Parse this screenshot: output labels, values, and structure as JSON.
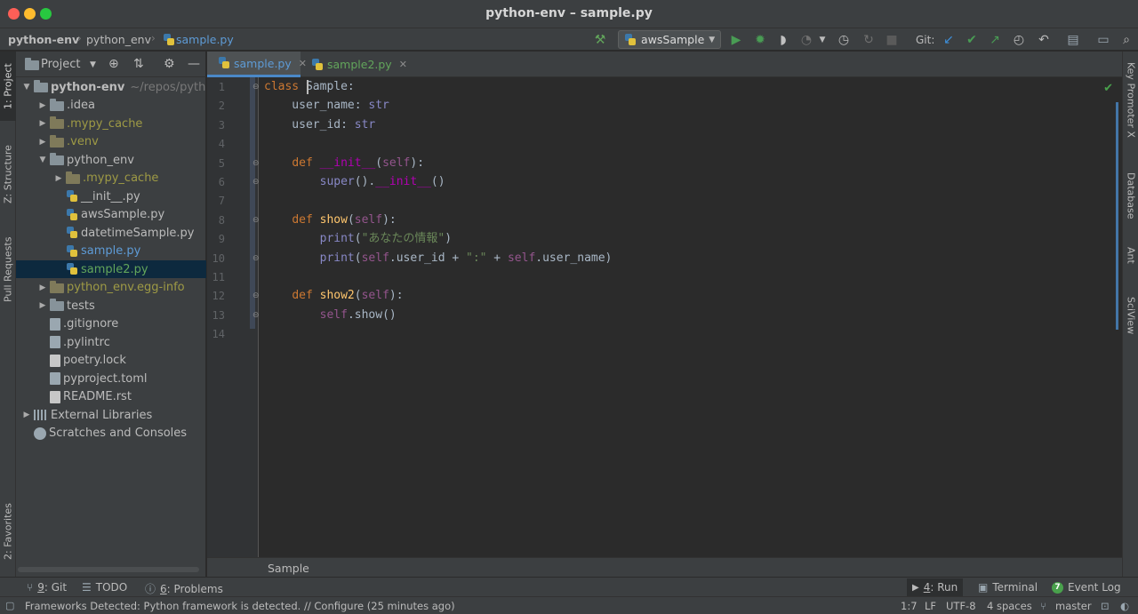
{
  "window": {
    "title": "python-env – sample.py"
  },
  "navbar": {
    "crumbs": [
      "python-env",
      "python_env",
      "sample.py"
    ],
    "run_config": "awsSample",
    "git_label": "Git:"
  },
  "left_strip": {
    "project": "1: Project",
    "structure": "Z: Structure",
    "pull_requests": "Pull Requests",
    "favorites": "2: Favorites"
  },
  "project_panel": {
    "title": "Project",
    "tree": [
      {
        "label": "python-env",
        "suffix": "~/repos/pytho",
        "kind": "folder",
        "depth": 0,
        "arrow": "down",
        "style": "bold"
      },
      {
        "label": ".idea",
        "kind": "folder",
        "depth": 1,
        "arrow": "right",
        "style": "normal"
      },
      {
        "label": ".mypy_cache",
        "kind": "folder-excluded",
        "depth": 1,
        "arrow": "right",
        "style": "excluded"
      },
      {
        "label": ".venv",
        "kind": "folder-excluded",
        "depth": 1,
        "arrow": "right",
        "style": "excluded"
      },
      {
        "label": "python_env",
        "kind": "folder",
        "depth": 1,
        "arrow": "down",
        "style": "normal"
      },
      {
        "label": ".mypy_cache",
        "kind": "folder-excluded",
        "depth": 2,
        "arrow": "right",
        "style": "excluded"
      },
      {
        "label": "__init__.py",
        "kind": "py",
        "depth": 2,
        "arrow": "",
        "style": "normal"
      },
      {
        "label": "awsSample.py",
        "kind": "py",
        "depth": 2,
        "arrow": "",
        "style": "normal"
      },
      {
        "label": "datetimeSample.py",
        "kind": "py",
        "depth": 2,
        "arrow": "",
        "style": "normal"
      },
      {
        "label": "sample.py",
        "kind": "py",
        "depth": 2,
        "arrow": "",
        "style": "blue"
      },
      {
        "label": "sample2.py",
        "kind": "py",
        "depth": 2,
        "arrow": "",
        "style": "green",
        "selected": true
      },
      {
        "label": "python_env.egg-info",
        "kind": "folder-excluded",
        "depth": 1,
        "arrow": "right",
        "style": "excluded"
      },
      {
        "label": "tests",
        "kind": "folder",
        "depth": 1,
        "arrow": "right",
        "style": "normal"
      },
      {
        "label": ".gitignore",
        "kind": "gear",
        "depth": 1,
        "arrow": "",
        "style": "normal"
      },
      {
        "label": ".pylintrc",
        "kind": "gear",
        "depth": 1,
        "arrow": "",
        "style": "normal"
      },
      {
        "label": "poetry.lock",
        "kind": "txt",
        "depth": 1,
        "arrow": "",
        "style": "normal"
      },
      {
        "label": "pyproject.toml",
        "kind": "gear",
        "depth": 1,
        "arrow": "",
        "style": "normal"
      },
      {
        "label": "README.rst",
        "kind": "txt",
        "depth": 1,
        "arrow": "",
        "style": "normal"
      },
      {
        "label": "External Libraries",
        "kind": "lib",
        "depth": 0,
        "arrow": "right",
        "style": "normal"
      },
      {
        "label": "Scratches and Consoles",
        "kind": "scratch",
        "depth": 0,
        "arrow": "",
        "style": "normal"
      }
    ]
  },
  "editor_tabs": [
    {
      "label": "sample.py",
      "active": true,
      "color": "#5e9bd6"
    },
    {
      "label": "sample2.py",
      "active": false,
      "color": "#62a55b"
    }
  ],
  "editor": {
    "line_numbers": [
      "1",
      "2",
      "3",
      "4",
      "5",
      "6",
      "7",
      "8",
      "9",
      "10",
      "11",
      "12",
      "13",
      "14"
    ],
    "lines": [
      [
        [
          "kw",
          "class "
        ],
        [
          "plain",
          "Sample:"
        ]
      ],
      [
        [
          "plain",
          "    user_name: "
        ],
        [
          "builtin",
          "str"
        ]
      ],
      [
        [
          "plain",
          "    user_id: "
        ],
        [
          "builtin",
          "str"
        ]
      ],
      [],
      [
        [
          "plain",
          "    "
        ],
        [
          "kw",
          "def "
        ],
        [
          "magic",
          "__init__"
        ],
        [
          "plain",
          "("
        ],
        [
          "selfc",
          "self"
        ],
        [
          "plain",
          "):"
        ]
      ],
      [
        [
          "plain",
          "        "
        ],
        [
          "builtin",
          "super"
        ],
        [
          "plain",
          "()."
        ],
        [
          "magic",
          "__init__"
        ],
        [
          "plain",
          "()"
        ]
      ],
      [],
      [
        [
          "plain",
          "    "
        ],
        [
          "kw",
          "def "
        ],
        [
          "fn",
          "show"
        ],
        [
          "plain",
          "("
        ],
        [
          "selfc",
          "self"
        ],
        [
          "plain",
          "):"
        ]
      ],
      [
        [
          "plain",
          "        "
        ],
        [
          "builtin",
          "print"
        ],
        [
          "plain",
          "("
        ],
        [
          "str",
          "\"あなたの情報\""
        ],
        [
          "plain",
          ")"
        ]
      ],
      [
        [
          "plain",
          "        "
        ],
        [
          "builtin",
          "print"
        ],
        [
          "plain",
          "("
        ],
        [
          "selfc",
          "self"
        ],
        [
          "plain",
          ".user_id + "
        ],
        [
          "str",
          "\":\""
        ],
        [
          "plain",
          " + "
        ],
        [
          "selfc",
          "self"
        ],
        [
          "plain",
          ".user_name)"
        ]
      ],
      [],
      [
        [
          "plain",
          "    "
        ],
        [
          "kw",
          "def "
        ],
        [
          "fn",
          "show2"
        ],
        [
          "plain",
          "("
        ],
        [
          "selfc",
          "self"
        ],
        [
          "plain",
          "):"
        ]
      ],
      [
        [
          "plain",
          "        "
        ],
        [
          "selfc",
          "self"
        ],
        [
          "plain",
          ".show()"
        ]
      ],
      []
    ],
    "breadcrumb": "Sample"
  },
  "right_strip": {
    "key_promoter": "Key Promoter X",
    "database": "Database",
    "ant": "Ant",
    "sciview": "SciView"
  },
  "bottom_tabs": {
    "git_num": "9",
    "git": ": Git",
    "todo": "TODO",
    "problems_num": "6",
    "problems": ": Problems",
    "run_num": "4",
    "run": ": Run",
    "terminal": "Terminal",
    "event_log_count": "7",
    "event_log": "Event Log"
  },
  "status": {
    "message": "Frameworks Detected: Python framework is detected. // Configure (25 minutes ago)",
    "position": "1:7",
    "line_sep": "LF",
    "encoding": "UTF-8",
    "indent": "4 spaces",
    "branch": "master"
  },
  "colors": {
    "accent": "#4a88c7",
    "selection": "#0d293e",
    "background": "#2b2b2b",
    "panel": "#3c3f41"
  }
}
